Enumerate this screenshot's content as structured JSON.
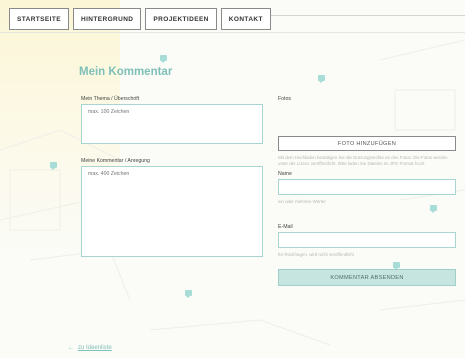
{
  "nav": {
    "items": [
      {
        "label": "STARTSEITE"
      },
      {
        "label": "HINTERGRUND"
      },
      {
        "label": "PROJEKTIDEEN"
      },
      {
        "label": "KONTAKT"
      }
    ]
  },
  "form": {
    "title": "Mein Kommentar",
    "topic_label": "Mein Thema / Überschrift",
    "topic_placeholder": "max. 100 Zeichen",
    "comment_label": "Meine Kommentar / Anregung",
    "comment_placeholder": "max. 400 Zeichen",
    "photo_label": "Fotos",
    "photo_button": "FOTO HINZUFÜGEN",
    "photo_hint": "Mit dem Hochladen bestätigen Sie die Nutzungsrechte an den Fotos. Die Fotos werden unter der Lizenz veröffentlicht. Bitte laden Sie Dateien im JPG-Format hoch.",
    "name_label": "Name",
    "name_hint": "ein oder mehrere Wörter",
    "email_label": "E-Mail",
    "email_hint": "für Rückfragen, wird nicht veröffentlicht",
    "submit_button": "KOMMENTAR ABSENDEN"
  },
  "footer": {
    "back_label": "zu Ideenliste"
  },
  "colors": {
    "accent": "#7fc0b8",
    "field_border": "#a9d5d0",
    "submit_bg": "#c6e5e0"
  }
}
